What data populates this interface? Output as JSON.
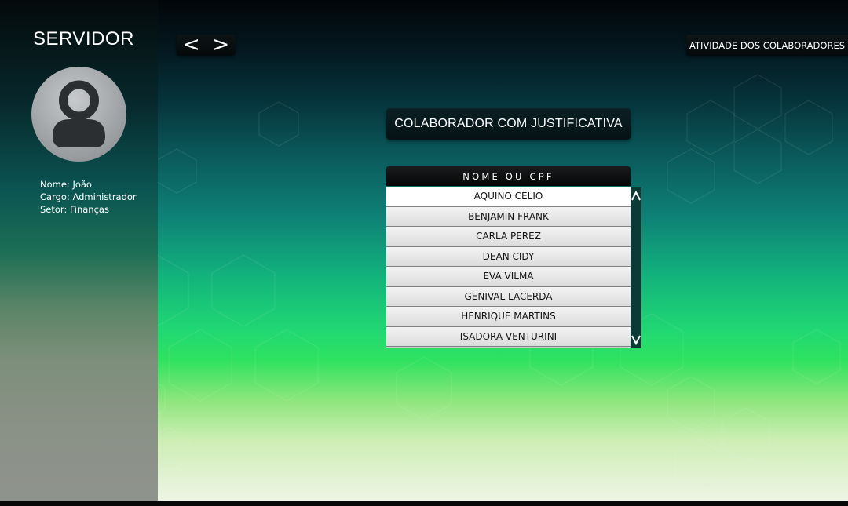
{
  "sidebar": {
    "title": "SERVIDOR",
    "user": {
      "name_line": "Nome: João",
      "role_line": "Cargo: Administrador",
      "sector_line": "Setor: Finanças"
    },
    "avatar_icon": "user-avatar-icon"
  },
  "nav": {
    "back_label": "<",
    "forward_label": ">"
  },
  "header": {
    "activity_button_label": "ATIVIDADE DOS COLABORADORES"
  },
  "main": {
    "section_title": "COLABORADOR COM JUSTIFICATIVA",
    "list": {
      "header_label": "NOME OU CPF",
      "items": [
        "AQUINO CÉLIO",
        "BENJAMIN FRANK",
        "CARLA PEREZ",
        "DEAN CIDY",
        "EVA VILMA",
        "GENIVAL LACERDA",
        "HENRIQUE MARTINS",
        "ISADORA VENTURINI"
      ],
      "selected_index": 0,
      "scroll_up_label": "^",
      "scroll_down_label": "v"
    }
  },
  "colors": {
    "sidebar_top": "#040a0b",
    "sidebar_bottom": "#8f938d",
    "background_green": "#20d873",
    "panel_dark": "#061214",
    "scrollbar": "#0b3b35"
  }
}
